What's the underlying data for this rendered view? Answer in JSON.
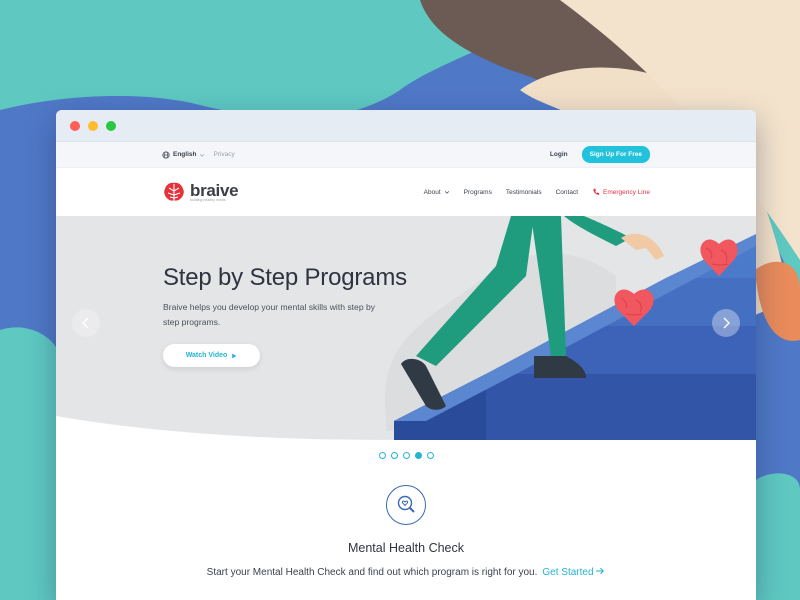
{
  "colors": {
    "accent": "#22c2dc",
    "emergency": "#e5314a",
    "stairs": "#3b62b3",
    "heart": "#f0575e"
  },
  "topbar": {
    "language": "English",
    "privacy": "Privacy",
    "login": "Login",
    "signup": "Sign Up For Free"
  },
  "brand": {
    "name": "braive",
    "tagline": "building healthy minds"
  },
  "nav": {
    "items": [
      "About",
      "Programs",
      "Testimonials",
      "Contact"
    ],
    "emergency": "Emergency Line"
  },
  "hero": {
    "title": "Step by Step Programs",
    "description": "Braive helps you develop your mental skills with step by step programs.",
    "cta": "Watch Video",
    "active_slide": 4,
    "total_slides": 5
  },
  "feature": {
    "icon": "heart-magnifier-icon",
    "title": "Mental Health Check",
    "text": "Start your Mental Health Check and find out which program is right for you.",
    "link": "Get Started"
  }
}
